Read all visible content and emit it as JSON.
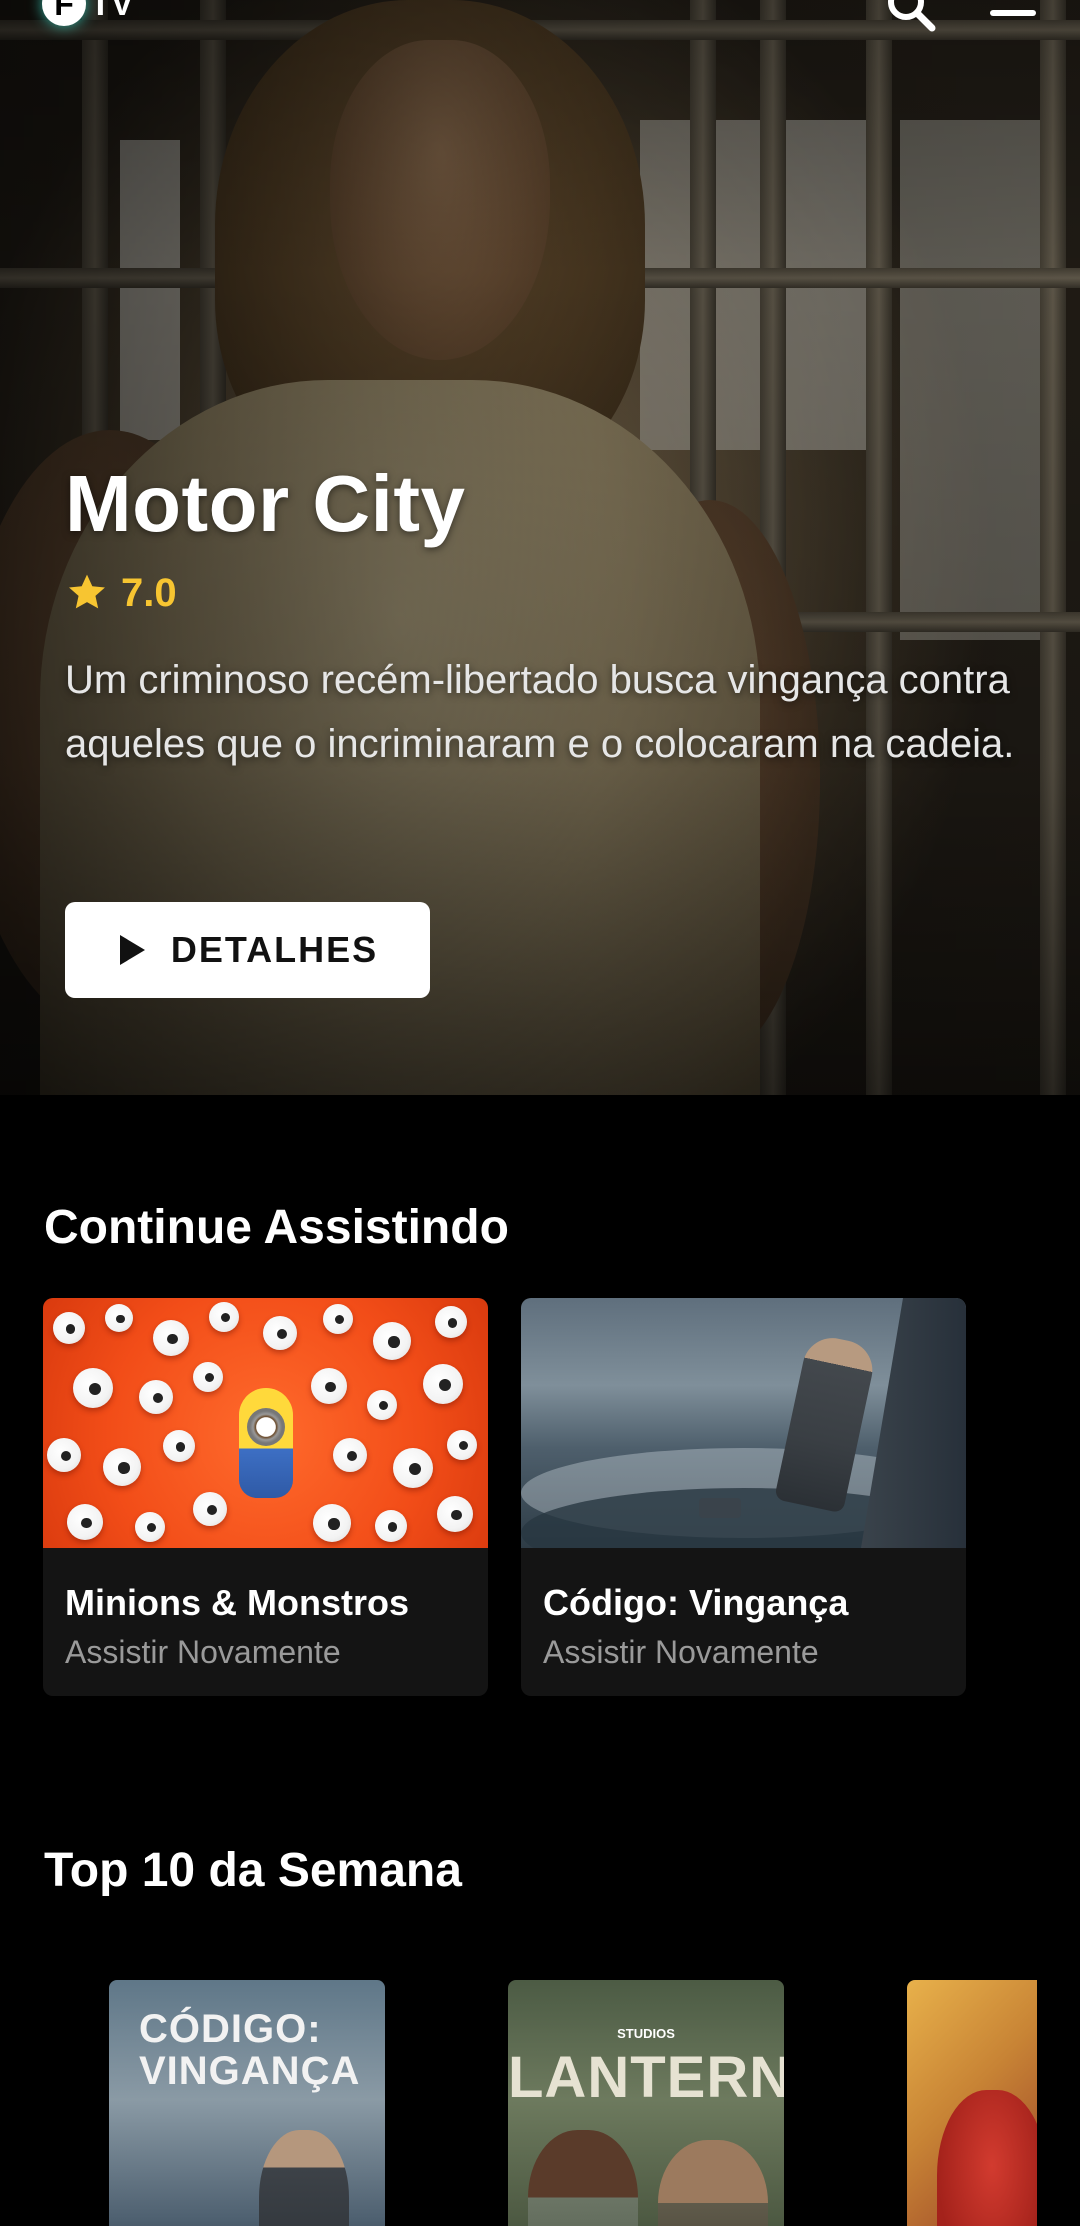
{
  "app": {
    "logo_letter": "F",
    "logo_word": "TV"
  },
  "header": {
    "search_icon": "search-icon",
    "menu_icon": "menu-icon"
  },
  "hero": {
    "title": "Motor City",
    "rating": "7.0",
    "description": "Um criminoso recém-libertado busca vingança contra aqueles que o incriminaram e o colocaram na cadeia.",
    "button_label": "DETALHES"
  },
  "continue_watching": {
    "title": "Continue Assistindo",
    "items": [
      {
        "title": "Minions & Monstros",
        "subtitle": "Assistir Novamente"
      },
      {
        "title": "Código: Vingança",
        "subtitle": "Assistir Novamente"
      }
    ]
  },
  "top10": {
    "title": "Top 10 da Semana",
    "posters": [
      {
        "label": "CÓDIGO:\nVINGANÇA"
      },
      {
        "label": "LANTERNAS",
        "badge": "STUDIOS"
      },
      {
        "label": ""
      }
    ]
  },
  "colors": {
    "accent_rating": "#f7c531",
    "background": "#000000",
    "card": "#141414"
  }
}
